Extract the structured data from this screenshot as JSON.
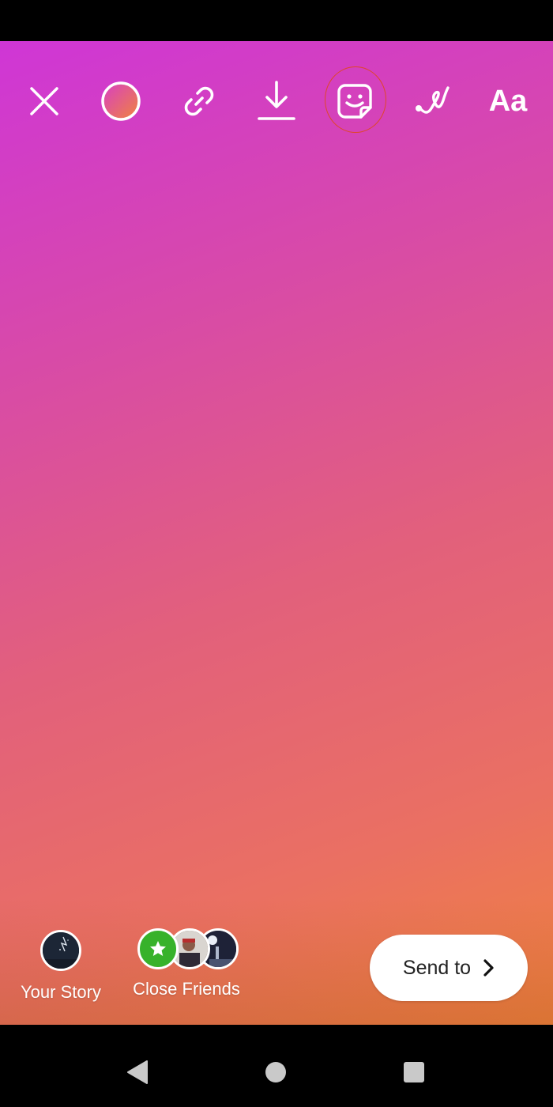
{
  "toolbar": {
    "close": {
      "icon": "close-icon"
    },
    "color": {
      "icon": "color-gradient-icon"
    },
    "link": {
      "icon": "link-icon"
    },
    "download": {
      "icon": "download-icon"
    },
    "sticker": {
      "icon": "sticker-icon",
      "highlighted": true,
      "highlight_color": "#e0462b"
    },
    "draw": {
      "icon": "draw-squiggle-icon"
    },
    "text": {
      "label": "Aa"
    }
  },
  "canvas": {
    "gradient_colors": [
      "#cf36d6",
      "#e2607c",
      "#f0823f"
    ]
  },
  "share": {
    "your_story": {
      "label": "Your Story"
    },
    "close_friends": {
      "label": "Close Friends",
      "badge_color": "#37b22a",
      "badge_icon": "star-icon"
    },
    "send_button": {
      "label": "Send to",
      "icon": "chevron-right-icon"
    }
  },
  "nav": {
    "back": {
      "icon": "back-triangle-icon"
    },
    "home": {
      "icon": "home-circle-icon"
    },
    "recents": {
      "icon": "recents-square-icon"
    }
  }
}
